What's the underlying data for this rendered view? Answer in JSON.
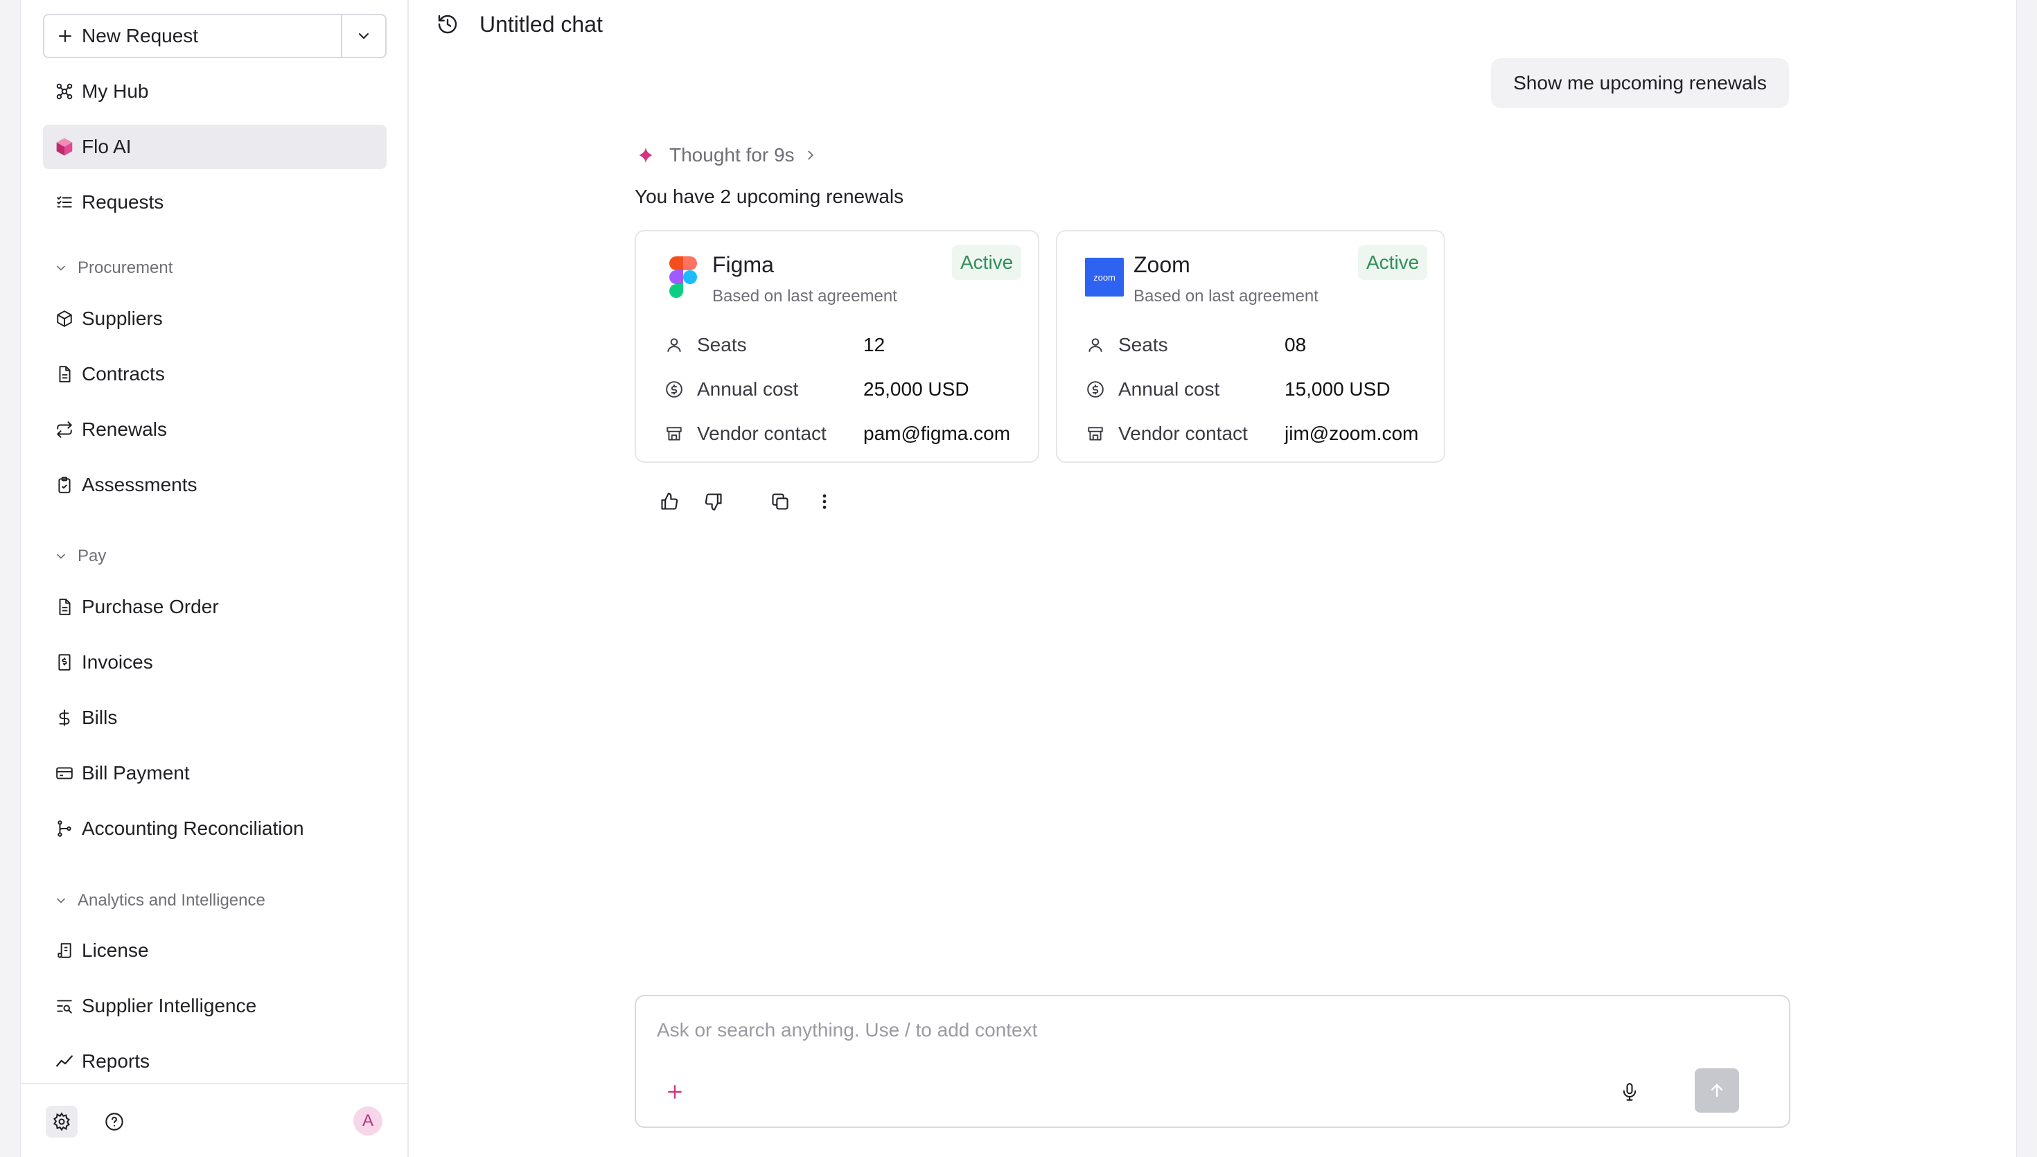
{
  "sidebar": {
    "new_request_label": "New Request",
    "items_top": [
      {
        "label": "My Hub",
        "icon": "hub-icon"
      },
      {
        "label": "Flo AI",
        "icon": "flo-ai-cube-icon"
      },
      {
        "label": "Requests",
        "icon": "list-checks-icon"
      }
    ],
    "sections": [
      {
        "title": "Procurement",
        "items": [
          {
            "label": "Suppliers",
            "icon": "package-icon"
          },
          {
            "label": "Contracts",
            "icon": "document-icon"
          },
          {
            "label": "Renewals",
            "icon": "repeat-icon"
          },
          {
            "label": "Assessments",
            "icon": "clipboard-check-icon"
          }
        ]
      },
      {
        "title": "Pay",
        "items": [
          {
            "label": "Purchase Order",
            "icon": "document-icon"
          },
          {
            "label": "Invoices",
            "icon": "receipt-icon"
          },
          {
            "label": "Bills",
            "icon": "dollar-icon"
          },
          {
            "label": "Bill Payment",
            "icon": "credit-card-icon"
          },
          {
            "label": "Accounting Reconciliation",
            "icon": "git-branch-icon"
          }
        ]
      },
      {
        "title": "Analytics and Intelligence",
        "items": [
          {
            "label": "License",
            "icon": "scroll-icon"
          },
          {
            "label": "Supplier Intelligence",
            "icon": "text-search-icon"
          },
          {
            "label": "Reports",
            "icon": "trend-icon"
          }
        ]
      }
    ],
    "avatar_initial": "A"
  },
  "chat": {
    "title": "Untitled chat",
    "user_message": "Show me upcoming renewals",
    "thought_label": "Thought for 9s",
    "answer_intro": "You have 2 upcoming renewals",
    "cards": [
      {
        "vendor": "Figma",
        "subtitle": "Based on last agreement",
        "status": "Active",
        "rows": [
          {
            "label": "Seats",
            "value": "12",
            "icon": "user-icon"
          },
          {
            "label": "Annual cost",
            "value": "25,000 USD",
            "icon": "dollar-circle-icon"
          },
          {
            "label": "Vendor contact",
            "value": "pam@figma.com",
            "icon": "store-icon"
          }
        ]
      },
      {
        "vendor": "Zoom",
        "subtitle": "Based on last agreement",
        "status": "Active",
        "logo_text": "zoom",
        "rows": [
          {
            "label": "Seats",
            "value": "08",
            "icon": "user-icon"
          },
          {
            "label": "Annual cost",
            "value": "15,000 USD",
            "icon": "dollar-circle-icon"
          },
          {
            "label": "Vendor contact",
            "value": "jim@zoom.com",
            "icon": "store-icon"
          }
        ]
      }
    ],
    "composer_placeholder": "Ask or search anything. Use / to add context"
  },
  "colors": {
    "accent_pink": "#d6337f",
    "active_green": "#2f8f5a",
    "zoom_blue": "#2d63f0"
  }
}
